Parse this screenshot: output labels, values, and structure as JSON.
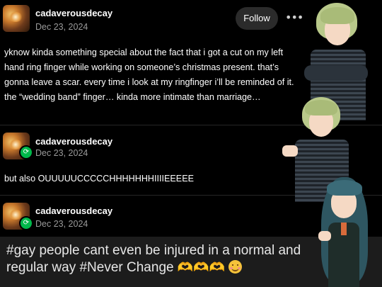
{
  "posts": [
    {
      "username": "cadaverousdecay",
      "date": "Dec 23, 2024",
      "follow_label": "Follow",
      "more_label": "•••",
      "body": "yknow kinda something special about the fact that i got a cut on my left hand ring finger while working on someone’s christmas present. that’s gonna leave a scar. every time i look at my ringfinger i’ll be reminded of it. the “wedding band” finger… kinda more intimate than marriage…",
      "reblog": false
    },
    {
      "username": "cadaverousdecay",
      "date": "Dec 23, 2024",
      "body": "but also OUUUUUCCCCCHHHHHHHIIIIEEEEE",
      "reblog": true
    },
    {
      "username": "cadaverousdecay",
      "date": "Dec 23, 2024",
      "reblog": true,
      "tags_text_1": "#gay people cant even be injured in a normal and",
      "tags_text_2": "regular way  #Never Change ",
      "emoji_hands": "🫶🫶🫶"
    }
  ],
  "icons": {
    "reblog_icon": "⟳"
  },
  "colors": {
    "background": "#000000",
    "date_text": "#9a9a9a",
    "follow_button_bg": "#2b2b2b",
    "reblog_badge": "#00b84a",
    "tag_box_bg": "#1c1c1c"
  }
}
